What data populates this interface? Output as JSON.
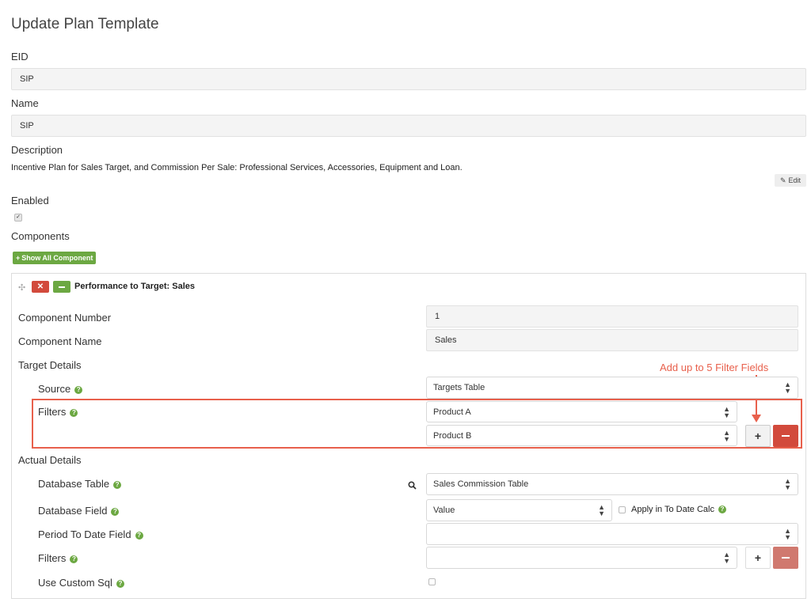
{
  "page": {
    "title": "Update Plan Template"
  },
  "eid": {
    "label": "EID",
    "value": "SIP"
  },
  "name": {
    "label": "Name",
    "value": "SIP"
  },
  "description": {
    "label": "Description",
    "text": "Incentive Plan for Sales Target, and Commission Per Sale: Professional Services, Accessories, Equipment and Loan.",
    "edit_label": "Edit"
  },
  "enabled": {
    "label": "Enabled",
    "checked": true
  },
  "components": {
    "label": "Components",
    "show_all_label": "Show All Component",
    "panel": {
      "title": "Performance to Target: Sales",
      "component_number": {
        "label": "Component Number",
        "value": "1"
      },
      "component_name": {
        "label": "Component Name",
        "value": "Sales"
      },
      "target_details": {
        "label": "Target Details",
        "source": {
          "label": "Source",
          "value": "Targets Table"
        },
        "filters": {
          "label": "Filters",
          "values": [
            "Product A",
            "Product B"
          ]
        }
      },
      "actual_details": {
        "label": "Actual Details",
        "database_table": {
          "label": "Database Table",
          "value": "Sales Commission Table"
        },
        "database_field": {
          "label": "Database Field",
          "value": "Value",
          "apply_label": "Apply in To Date Calc"
        },
        "period_to_date": {
          "label": "Period To Date Field",
          "value": ""
        },
        "filters": {
          "label": "Filters",
          "value": ""
        },
        "custom_sql": {
          "label": "Use Custom Sql"
        }
      }
    }
  },
  "annotation": {
    "text": "Add up to 5 Filter Fields",
    "color": "#e8604c"
  },
  "colors": {
    "green": "#6ca842",
    "red": "#d24a3c"
  }
}
